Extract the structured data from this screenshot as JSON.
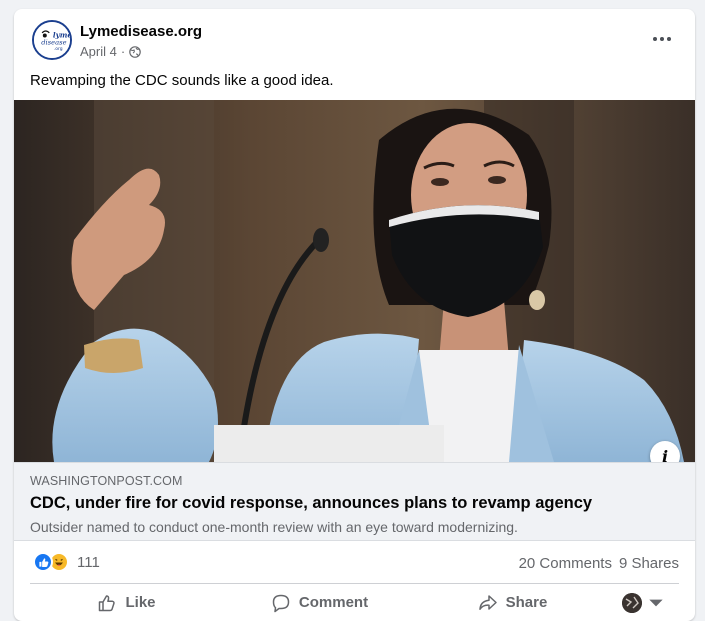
{
  "post": {
    "page_name": "Lymedisease.org",
    "date": "April 4",
    "separator": "·",
    "text": "Revamping the CDC sounds like a good idea.",
    "avatar_logo_text": "lyme disease .org"
  },
  "link": {
    "domain": "WASHINGTONPOST.COM",
    "title": "CDC, under fire for covid response, announces plans to revamp agency",
    "description": "Outsider named to conduct one-month review with an eye toward modernizing."
  },
  "stats": {
    "reactions": [
      "like",
      "haha"
    ],
    "reaction_count": "111",
    "comments": "20 Comments",
    "shares": "9 Shares"
  },
  "actions": {
    "like": "Like",
    "comment": "Comment",
    "share": "Share"
  },
  "icons": {
    "more": "more-horizontal-icon",
    "globe": "globe-icon",
    "info": "info-icon"
  },
  "colors": {
    "facebook_blue": "#1877f2",
    "haha_yellow": "#f7b928",
    "secondary_text": "#65676b"
  }
}
